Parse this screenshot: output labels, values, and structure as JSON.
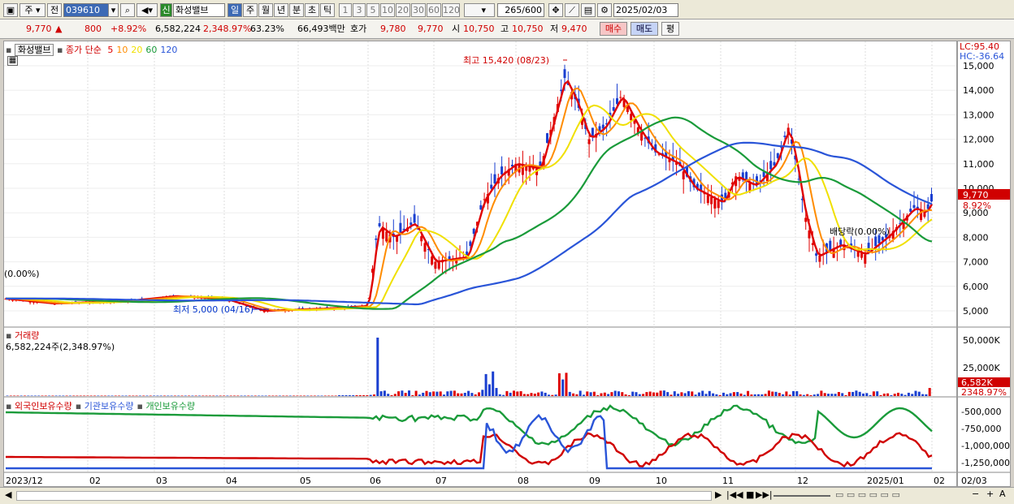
{
  "toolbar": {
    "period": "주",
    "market": "전",
    "code": "039610",
    "new_badge": "신",
    "stock_name": "화성밸브",
    "intervals": [
      "일",
      "주",
      "월",
      "년",
      "분",
      "초",
      "틱"
    ],
    "selected_interval": "일",
    "ticks": [
      "1",
      "3",
      "5",
      "10",
      "20",
      "30",
      "60",
      "120"
    ],
    "count": "265",
    "count_max": "/600",
    "date": "2025/02/03"
  },
  "quote": {
    "price": "9,770",
    "change_sign": "▲",
    "change": "800",
    "change_pct": "+8.92%",
    "volume": "6,582,224",
    "volume_pct": "2,348.97%",
    "turnover": "63.23%",
    "amount": "66,493백만",
    "ask_label": "호가",
    "ask": "9,780",
    "bid": "9,770",
    "open_label": "시",
    "open": "10,750",
    "high_label": "고",
    "high": "10,750",
    "low_label": "저",
    "low": "9,470",
    "buy": "매수",
    "sell": "매도",
    "eval": "평"
  },
  "main_panel": {
    "name_tag": "화성밸브",
    "indicator": "종가 단순",
    "ma": [
      {
        "period": "5",
        "color": "#e00000"
      },
      {
        "period": "10",
        "color": "#ff8c00"
      },
      {
        "period": "20",
        "color": "#f0e000"
      },
      {
        "period": "60",
        "color": "#1a9b3a"
      },
      {
        "period": "120",
        "color": "#2a55d8"
      }
    ],
    "high_note": "최고 15,420 (08/23)",
    "low_note": "최저 5,000 (04/16)",
    "left_note": "(0.00%)",
    "div_note": "배당락(0.00%)",
    "lc": "LC:95.40",
    "hc": "HC:-36.64",
    "price_ticks": [
      "15,000",
      "14,000",
      "13,000",
      "12,000",
      "11,000",
      "10,000",
      "9,000",
      "8,000",
      "7,000",
      "6,000",
      "5,000"
    ],
    "current_price": "9,770",
    "current_pct": "8.92%"
  },
  "volume_panel": {
    "title": "거래량",
    "value": "6,582,224주(2,348.97%)",
    "ticks": [
      "50,000K",
      "25,000K"
    ],
    "current": "6,582K",
    "current_pct": "2348.97%"
  },
  "holding_panel": {
    "series": [
      "외국인보유수량",
      "기관보유수량",
      "개인보유수량"
    ],
    "ticks": [
      "-500,000",
      "-750,000",
      "-1,000,000",
      "-1,250,000"
    ]
  },
  "x_axis": [
    "2023/12",
    "02",
    "03",
    "04",
    "05",
    "06",
    "07",
    "08",
    "09",
    "10",
    "11",
    "12",
    "2025/01",
    "02",
    "02/03"
  ]
}
